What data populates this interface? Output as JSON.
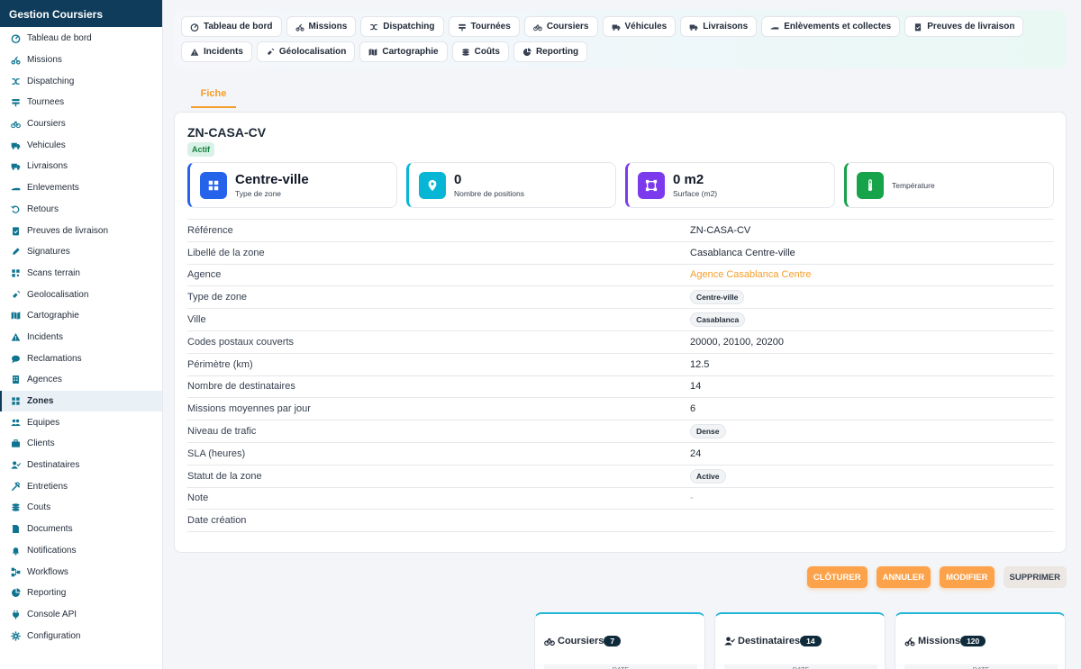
{
  "sidebar": {
    "title": "Gestion Coursiers",
    "items": [
      {
        "label": "Tableau de bord",
        "icon": "dashboard-icon"
      },
      {
        "label": "Missions",
        "icon": "bike-route-icon"
      },
      {
        "label": "Dispatching",
        "icon": "shuffle-icon"
      },
      {
        "label": "Tournees",
        "icon": "signpost-icon"
      },
      {
        "label": "Coursiers",
        "icon": "bicycle-icon"
      },
      {
        "label": "Vehicules",
        "icon": "truck-icon"
      },
      {
        "label": "Livraisons",
        "icon": "delivery-truck-icon"
      },
      {
        "label": "Enlevements",
        "icon": "pickup-icon"
      },
      {
        "label": "Retours",
        "icon": "return-icon"
      },
      {
        "label": "Preuves de livraison",
        "icon": "clipboard-check-icon"
      },
      {
        "label": "Signatures",
        "icon": "pen-icon"
      },
      {
        "label": "Scans terrain",
        "icon": "qr-icon"
      },
      {
        "label": "Geolocalisation",
        "icon": "satellite-icon"
      },
      {
        "label": "Cartographie",
        "icon": "map-icon"
      },
      {
        "label": "Incidents",
        "icon": "warning-icon"
      },
      {
        "label": "Reclamations",
        "icon": "comment-icon"
      },
      {
        "label": "Agences",
        "icon": "building-icon"
      },
      {
        "label": "Zones",
        "icon": "grid-icon",
        "active": true
      },
      {
        "label": "Equipes",
        "icon": "users-icon"
      },
      {
        "label": "Clients",
        "icon": "briefcase-icon"
      },
      {
        "label": "Destinataires",
        "icon": "user-check-icon"
      },
      {
        "label": "Entretiens",
        "icon": "tools-icon"
      },
      {
        "label": "Couts",
        "icon": "coins-icon"
      },
      {
        "label": "Documents",
        "icon": "document-icon"
      },
      {
        "label": "Notifications",
        "icon": "bell-icon"
      },
      {
        "label": "Workflows",
        "icon": "workflow-icon"
      },
      {
        "label": "Reporting",
        "icon": "pie-chart-icon"
      },
      {
        "label": "Console API",
        "icon": "plug-icon"
      },
      {
        "label": "Configuration",
        "icon": "gear-icon"
      }
    ]
  },
  "topnav": [
    {
      "label": "Tableau de bord",
      "icon": "dashboard-icon"
    },
    {
      "label": "Missions",
      "icon": "bike-route-icon"
    },
    {
      "label": "Dispatching",
      "icon": "shuffle-icon"
    },
    {
      "label": "Tournées",
      "icon": "signpost-icon"
    },
    {
      "label": "Coursiers",
      "icon": "bicycle-icon"
    },
    {
      "label": "Véhicules",
      "icon": "truck-icon"
    },
    {
      "label": "Livraisons",
      "icon": "delivery-truck-icon"
    },
    {
      "label": "Enlèvements et collectes",
      "icon": "pickup-icon"
    },
    {
      "label": "Preuves de livraison",
      "icon": "clipboard-check-icon"
    },
    {
      "label": "Incidents",
      "icon": "warning-icon"
    },
    {
      "label": "Géolocalisation",
      "icon": "satellite-icon"
    },
    {
      "label": "Cartographie",
      "icon": "map-icon"
    },
    {
      "label": "Coûts",
      "icon": "coins-icon"
    },
    {
      "label": "Reporting",
      "icon": "pie-chart-icon"
    }
  ],
  "tab": {
    "label": "Fiche"
  },
  "record": {
    "title": "ZN-CASA-CV",
    "status": "Actif",
    "stats": [
      {
        "value": "Centre-ville",
        "label": "Type de zone",
        "color": "#2563eb",
        "icon": "grid-icon"
      },
      {
        "value": "0",
        "label": "Nombre de positions",
        "color": "#06b6d4",
        "icon": "map-pin-icon"
      },
      {
        "value": "0 m2",
        "label": "Surface (m2)",
        "color": "#7c3aed",
        "icon": "vector-square-icon"
      },
      {
        "value": "",
        "label": "Température",
        "color": "#16a34a",
        "icon": "thermometer-icon"
      }
    ],
    "fields": [
      {
        "label": "Référence",
        "value": "ZN-CASA-CV",
        "type": "text"
      },
      {
        "label": "Libellé de la zone",
        "value": "Casablanca Centre-ville",
        "type": "text"
      },
      {
        "label": "Agence",
        "value": "Agence Casablanca Centre",
        "type": "link"
      },
      {
        "label": "Type de zone",
        "value": "Centre-ville",
        "type": "chip"
      },
      {
        "label": "Ville",
        "value": "Casablanca",
        "type": "chip"
      },
      {
        "label": "Codes postaux couverts",
        "value": "20000, 20100, 20200",
        "type": "text"
      },
      {
        "label": "Périmètre (km)",
        "value": "12.5",
        "type": "text"
      },
      {
        "label": "Nombre de destinataires",
        "value": "14",
        "type": "text"
      },
      {
        "label": "Missions moyennes par jour",
        "value": "6",
        "type": "text"
      },
      {
        "label": "Niveau de trafic",
        "value": "Dense",
        "type": "chip"
      },
      {
        "label": "SLA (heures)",
        "value": "24",
        "type": "text"
      },
      {
        "label": "Statut de la zone",
        "value": "Active",
        "type": "chip"
      },
      {
        "label": "Note",
        "value": "-",
        "type": "muted"
      },
      {
        "label": "Date création",
        "value": "",
        "type": "text"
      }
    ]
  },
  "actions": {
    "close": "CLÔTURER",
    "cancel": "ANNULER",
    "edit": "MODIFIER",
    "delete": "SUPPRIMER"
  },
  "related": [
    {
      "title": "Coursiers",
      "count": "7",
      "sub": "DATE",
      "icon": "bicycle-icon"
    },
    {
      "title": "Destinataires",
      "count": "14",
      "sub": "DATE",
      "icon": "user-check-icon"
    },
    {
      "title": "Missions",
      "count": "120",
      "sub": "DATE",
      "icon": "bike-route-icon"
    }
  ],
  "colors": {
    "brand": "#0f3c5a",
    "accent": "#f59e2b",
    "teal": "#0e7490"
  }
}
